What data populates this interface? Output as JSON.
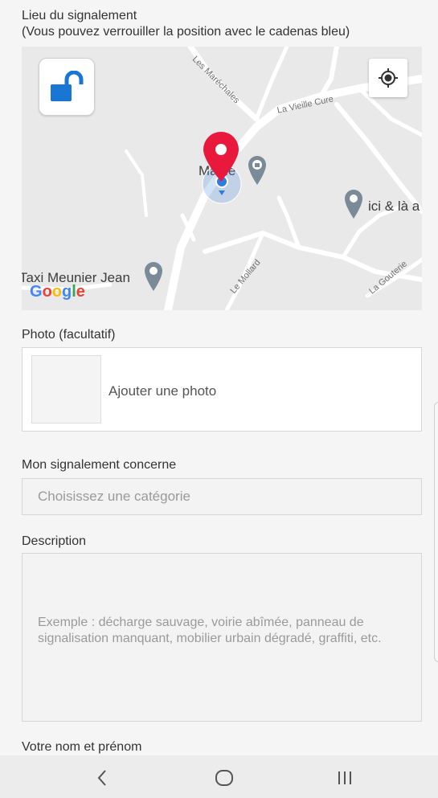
{
  "location": {
    "title": "Lieu du signalement",
    "subtitle": "(Vous pouvez verrouiller la position avec le cadenas bleu)"
  },
  "map": {
    "road_labels": {
      "marechales": "Les Maréchales",
      "vieille_cure": "La Vieille Cure",
      "mollard": "Le Mollard",
      "gouterie": "La Gouterie"
    },
    "poi_labels": {
      "mairie": "Mairie",
      "ici_la": "ici & là a",
      "taxi": "Taxi Meunier Jean"
    },
    "google_logo": [
      "G",
      "o",
      "o",
      "g",
      "l",
      "e"
    ],
    "google_colors": [
      "#4285F4",
      "#EA4335",
      "#FBBC05",
      "#4285F4",
      "#34A853",
      "#EA4335"
    ],
    "lock_color": "#1976d2",
    "marker_color": "#e8193c",
    "lock_icon": "unlocked-padlock-icon",
    "locate_icon": "my-location-icon"
  },
  "photo": {
    "title": "Photo (facultatif)",
    "add_label": "Ajouter une photo"
  },
  "category": {
    "title": "Mon signalement concerne",
    "placeholder": "Choisissez une catégorie"
  },
  "description": {
    "title": "Description",
    "placeholder": "Exemple : décharge sauvage, voirie abîmée, panneau de signalisation manquant, mobilier urbain dégradé, graffiti, etc."
  },
  "name": {
    "title": "Votre nom et prénom"
  },
  "navbar": {
    "back_icon": "back-chevron-icon",
    "home_icon": "home-icon",
    "recents_icon": "recents-icon"
  }
}
